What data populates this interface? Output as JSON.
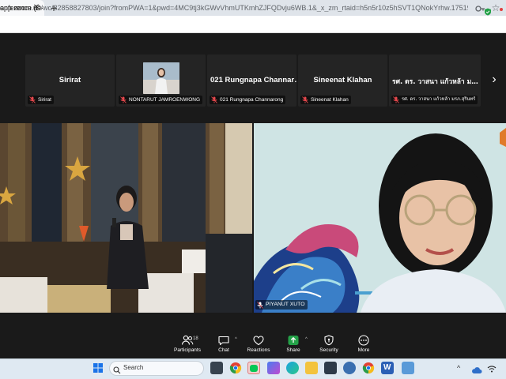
{
  "browser": {
    "tab_title": "onference (D·",
    "close_glyph": "✕",
    "new_tab_glyph": "+",
    "url_host": "app.zoom.us",
    "url_rest": "/wc/82858827803/join?fromPWA=1&pwd=4MC9tj3kGWvVhmUTKmhZJFQDvju6WB.1&_x_zm_rtaid=h5n5r10z5hSVT1QNokYrhw.1751936368622.c1e37e305b...",
    "icons": [
      "close-icon",
      "plus-icon",
      "password-key-icon",
      "star-icon"
    ]
  },
  "zoom": {
    "strip_next_glyph": "›",
    "participants": [
      {
        "display": "Sirirat",
        "label": "Sirirat",
        "muted": true
      },
      {
        "display": "",
        "label": "NONTARUT JAMROENWONG",
        "muted": true,
        "has_photo": true
      },
      {
        "display": "021 Rungnapa Channar…",
        "label": "021 Rungnapa Channarong",
        "muted": true
      },
      {
        "display": "Sineenat Klahan",
        "label": "Sineenat Klahan",
        "muted": true
      },
      {
        "display": "รศ. ดร. วาสนา แก้วหล้า ม…",
        "label": "รศ. ดร. วาสนา แก้วหล้า มรภ.สุรินทร์",
        "muted": true
      }
    ],
    "speaker_label": "PIYANUT XUTO",
    "participant_count": "18",
    "toolbar": [
      {
        "label": "Participants",
        "icon": "participants-icon"
      },
      {
        "label": "Chat",
        "icon": "chat-icon"
      },
      {
        "label": "Reactions",
        "icon": "heart-icon"
      },
      {
        "label": "Share",
        "icon": "share-icon"
      },
      {
        "label": "Security",
        "icon": "shield-icon"
      },
      {
        "label": "More",
        "icon": "more-icon"
      }
    ],
    "caret_glyph": "^",
    "colors": {
      "share_green": "#24a148",
      "muted_red": "#e5484d",
      "bg": "#1a1a1a"
    }
  },
  "taskbar": {
    "search_label": "Search",
    "icons": [
      "windows-start-icon",
      "search-icon",
      "taskview-icon",
      "chrome-icon",
      "line-icon",
      "copilot-icon",
      "edge-icon",
      "file-explorer-icon",
      "zoom-icon",
      "chrome-profile-icon",
      "chrome-icon",
      "word-icon",
      "app-icon",
      "chevron-up-icon",
      "cloud-icon",
      "wifi-icon"
    ]
  }
}
